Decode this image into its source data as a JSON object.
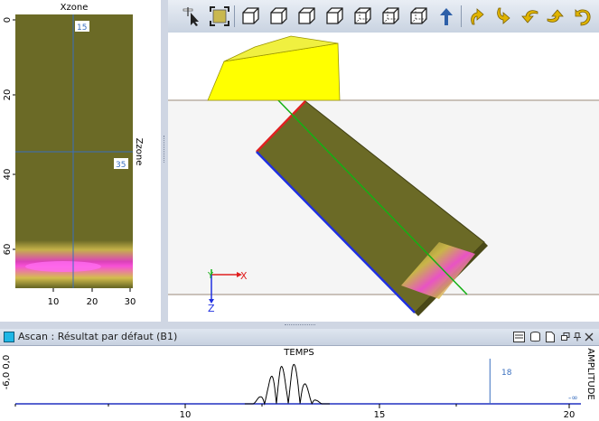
{
  "cscan": {
    "top_axis_title": "Xzone",
    "right_axis_title": "Zzone",
    "cursor_x_value": "15",
    "cursor_y_value": "35",
    "y_ticks": [
      "0",
      "20",
      "40",
      "60"
    ],
    "x_ticks": [
      "10",
      "20",
      "30"
    ]
  },
  "toolbar": {
    "buttons": [
      {
        "name": "pointer-select-icon"
      },
      {
        "name": "zoom-fit-icon"
      },
      {
        "name": "view-cube-1-icon"
      },
      {
        "name": "view-cube-2-icon"
      },
      {
        "name": "view-cube-3-icon"
      },
      {
        "name": "view-cube-4-icon"
      },
      {
        "name": "view-cube-5-icon"
      },
      {
        "name": "view-cube-6-icon"
      },
      {
        "name": "view-cube-7-icon"
      },
      {
        "name": "axis-up-icon"
      },
      {
        "name": "rotate-up-icon"
      },
      {
        "name": "rotate-down-icon"
      },
      {
        "name": "rotate-left-icon"
      },
      {
        "name": "rotate-right-icon"
      },
      {
        "name": "rotate-back-icon"
      }
    ]
  },
  "view3d": {
    "axis_x_label": "X",
    "axis_y_label": "Y",
    "axis_z_label": "Z"
  },
  "ascan": {
    "title": "Ascan : Résultat par défaut (B1)",
    "top_label": "TEMPS",
    "right_label": "AMPLITUDE",
    "left_label": "-6,0 0,0",
    "cursor_value": "18",
    "minus_inf": "-∞",
    "x_ticks": [
      "10",
      "15",
      "20"
    ]
  },
  "chart_data": {
    "type": "line",
    "title": "",
    "xlabel": "TEMPS",
    "ylabel": "AMPLITUDE",
    "xlim": [
      6.0,
      20.3
    ],
    "x": [
      12.0,
      12.2,
      12.4,
      12.55,
      12.7,
      12.85,
      13.0,
      13.15,
      13.3,
      13.45,
      13.6,
      13.75
    ],
    "y": [
      0.0,
      0.2,
      0.5,
      0.9,
      1.0,
      0.7,
      1.0,
      0.9,
      0.55,
      0.3,
      0.1,
      0.0
    ],
    "cursor_x": 18
  },
  "colors": {
    "part": "#6b6a26",
    "probe": "#ffff00",
    "accent": "#3a6fbf",
    "titlebar": "#d6deea"
  }
}
